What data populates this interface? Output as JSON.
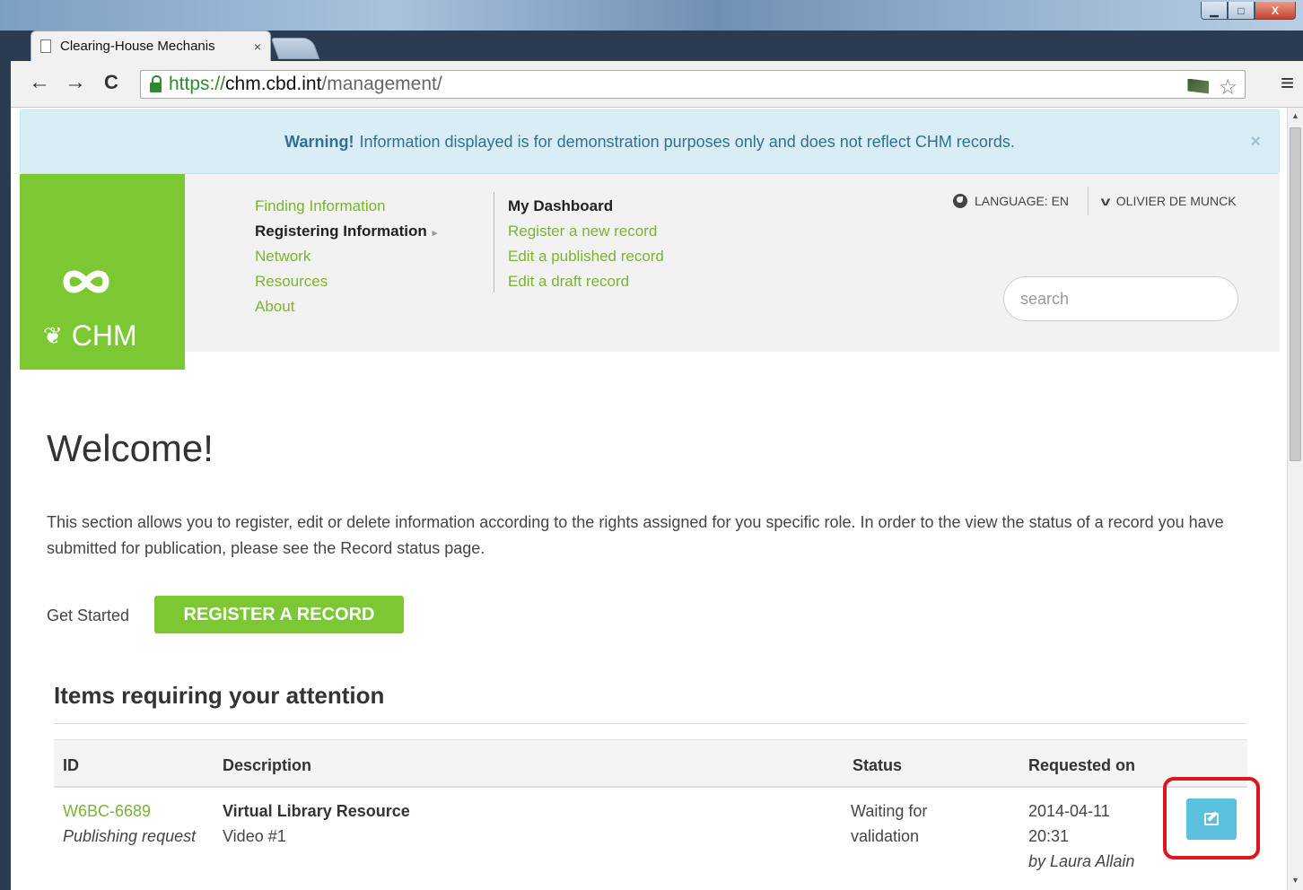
{
  "browser": {
    "tab_title": "Clearing-House Mechanis",
    "tab_close": "×",
    "url_scheme": "https://",
    "url_host": "chm.cbd.int",
    "url_path": "/management/",
    "back": "←",
    "forward": "→",
    "reload": "C",
    "menu": "≡",
    "star": "☆",
    "win_min": "▁",
    "win_max": "□",
    "win_close": "X"
  },
  "alert": {
    "strong": "Warning!",
    "text": "Information displayed is for demonstration purposes only and does not reflect CHM records.",
    "close": "×"
  },
  "logo": {
    "text": "CHM",
    "leaf": "❦"
  },
  "nav": {
    "primary": [
      {
        "label": "Finding Information"
      },
      {
        "label": "Registering Information"
      },
      {
        "label": "Network"
      },
      {
        "label": "Resources"
      },
      {
        "label": "About"
      }
    ],
    "caret": "▸",
    "secondary_heading": "My Dashboard",
    "secondary": [
      {
        "label": "Register a new record"
      },
      {
        "label": "Edit a published record"
      },
      {
        "label": "Edit a draft record"
      }
    ]
  },
  "header": {
    "language_label": "LANGUAGE: EN",
    "user_name": "OLIVIER DE MUNCK",
    "chevron": "v",
    "search_placeholder": "search"
  },
  "main": {
    "title": "Welcome!",
    "intro": "This section allows you to register, edit or delete information according to the rights assigned for you specific role. In order to the view the status of a record you have submitted for publication, please see the Record status page.",
    "get_started": "Get Started",
    "register_button": "REGISTER A RECORD",
    "section_title": "Items requiring your attention"
  },
  "table": {
    "headers": {
      "id": "ID",
      "description": "Description",
      "status": "Status",
      "requested_on": "Requested on"
    },
    "rows": [
      {
        "id": "W6BC-6689",
        "id_sub": "Publishing request",
        "desc_title": "Virtual Library Resource",
        "desc_sub": "Video #1",
        "status": "Waiting for validation",
        "requested_date": "2014-04-11",
        "requested_time": "20:31",
        "requested_by": "by Laura Allain"
      }
    ]
  },
  "colors": {
    "brand_green": "#7bc832",
    "info_blue": "#5bc0de",
    "highlight_red": "#e0141e"
  }
}
